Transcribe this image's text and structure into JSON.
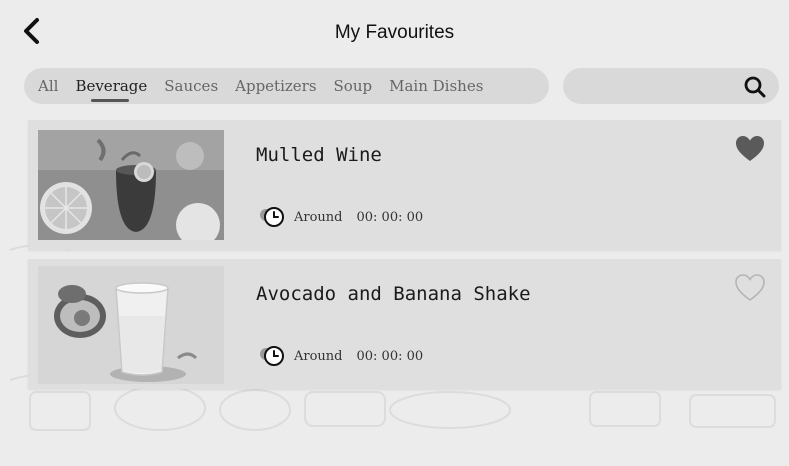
{
  "header": {
    "title": "My Favourites",
    "back_icon": "chevron-left-icon"
  },
  "tabs": [
    {
      "label": "All",
      "active": false
    },
    {
      "label": "Beverage",
      "active": true
    },
    {
      "label": "Sauces",
      "active": false
    },
    {
      "label": "Appetizers",
      "active": false
    },
    {
      "label": "Soup",
      "active": false
    },
    {
      "label": "Main Dishes",
      "active": false
    }
  ],
  "search": {
    "value": "",
    "placeholder": "",
    "icon": "search-icon"
  },
  "recipes": [
    {
      "name": "Mulled Wine",
      "time_prefix": "Around",
      "time": "00: 00: 00",
      "favourite": true,
      "image": "mulled-wine-image"
    },
    {
      "name": "Avocado and Banana Shake",
      "time_prefix": "Around",
      "time": "00: 00: 00",
      "favourite": false,
      "image": "avocado-banana-shake-image"
    }
  ],
  "colors": {
    "background": "#ececec",
    "pill": "#d9d9d9",
    "card": "#dfdfdf",
    "heart_filled": "#5a5a5a",
    "heart_outline": "#b5b5b5"
  }
}
